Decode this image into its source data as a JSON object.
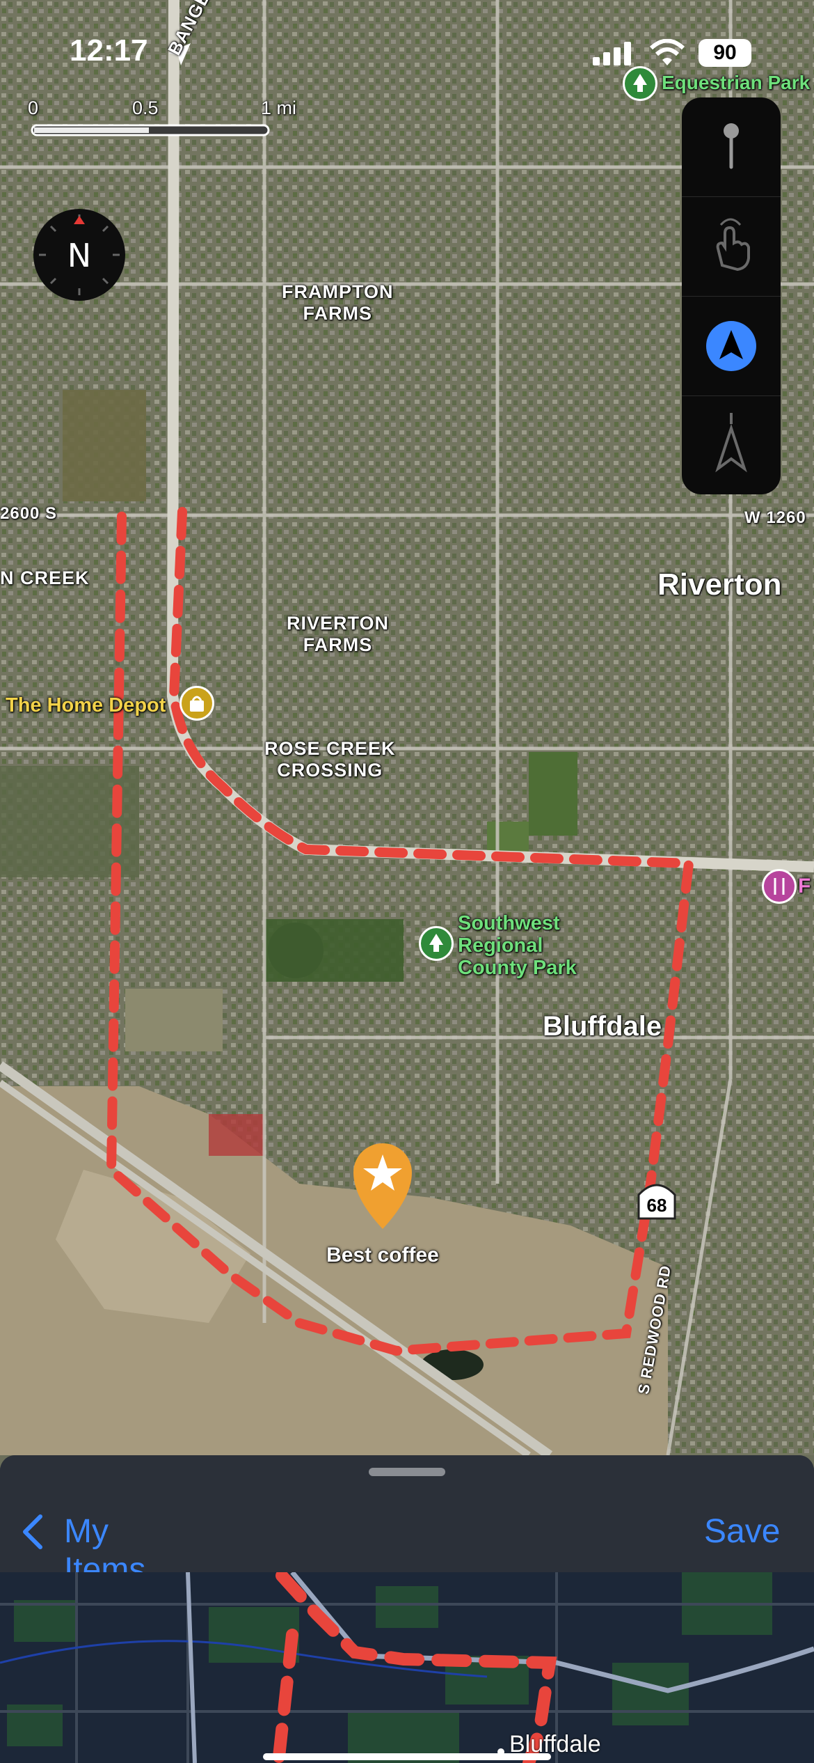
{
  "status_bar": {
    "time": "12:17",
    "battery": "90"
  },
  "scale": {
    "labels": [
      "0",
      "0.5",
      "1 mi"
    ]
  },
  "compass": {
    "label": "N"
  },
  "map_controls": [
    "pin",
    "hand",
    "navigation-arrow",
    "direction-arrow"
  ],
  "labels": {
    "street_bangerter": "BANGERTER H",
    "equestrian_park": "Equestrian Park",
    "frampton_farms": "FRAMPTON\nFARMS",
    "street_2600s": "2600 S",
    "street_w1260": "W 1260",
    "creek": "N CREEK",
    "riverton": "Riverton",
    "riverton_farms": "RIVERTON\nFARMS",
    "home_depot": "The Home Depot",
    "rose_creek": "ROSE CREEK\nCROSSING",
    "southwest_park": "Southwest\nRegional\nCounty Park",
    "bluffdale": "Bluffdale",
    "route_68": "68",
    "redwood_rd": "S REDWOOD RD",
    "best_coffee": "Best coffee",
    "edge_poi": "F"
  },
  "sheet": {
    "back_label": "My Items",
    "save_label": "Save",
    "preview_city": "Bluffdale"
  },
  "colors": {
    "accent": "#3b87ff",
    "route": "#e8453c",
    "pin": "#f0a030",
    "park": "#2f8a3a",
    "shop": "#caa21b"
  }
}
